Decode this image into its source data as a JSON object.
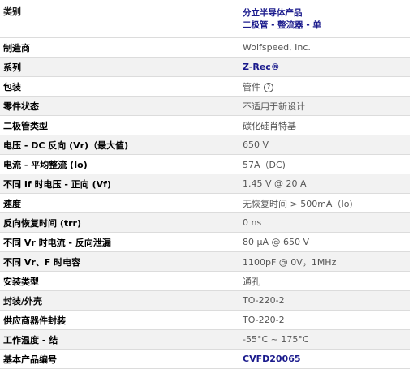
{
  "header": {
    "label": "类别",
    "value_line1": "分立半导体产品",
    "value_line2": "二极管 - 整流器 - 单"
  },
  "rows": [
    {
      "label": "制造商",
      "value": "Wolfspeed, Inc."
    },
    {
      "label": "系列",
      "value": "Z-Rec®"
    },
    {
      "label": "包装",
      "value": "管件",
      "help_icon": "?"
    },
    {
      "label": "零件状态",
      "value": "不适用于新设计"
    },
    {
      "label": "二极管类型",
      "value": "碳化硅肖特基"
    },
    {
      "label": "电压 - DC 反向 (Vr)（最大值)",
      "value": "650 V"
    },
    {
      "label": "电流 - 平均整流 (Io)",
      "value": "57A（DC)"
    },
    {
      "label": "不同 If 时电压 - 正向 (Vf)",
      "value": "1.45 V @ 20 A"
    },
    {
      "label": "速度",
      "value": "无恢复时间 > 500mA（Io)"
    },
    {
      "label": "反向恢复时间 (trr)",
      "value": "0 ns"
    },
    {
      "label": "不同 Vr 时电流 - 反向泄漏",
      "value": "80 µA @ 650 V"
    },
    {
      "label": "不同 Vr、F 时电容",
      "value": "1100pF @ 0V，1MHz"
    },
    {
      "label": "安装类型",
      "value": "通孔"
    },
    {
      "label": "封装/外壳",
      "value": "TO-220-2"
    },
    {
      "label": "供应商器件封装",
      "value": "TO-220-2"
    },
    {
      "label": "工作温度 - 结",
      "value": "-55°C ~ 175°C"
    },
    {
      "label": "基本产品编号",
      "value": "CVFD20065"
    }
  ],
  "colors": {
    "link": "#1a1a8c",
    "row_stripe": "#f2f2f2",
    "value_text": "#555555"
  }
}
